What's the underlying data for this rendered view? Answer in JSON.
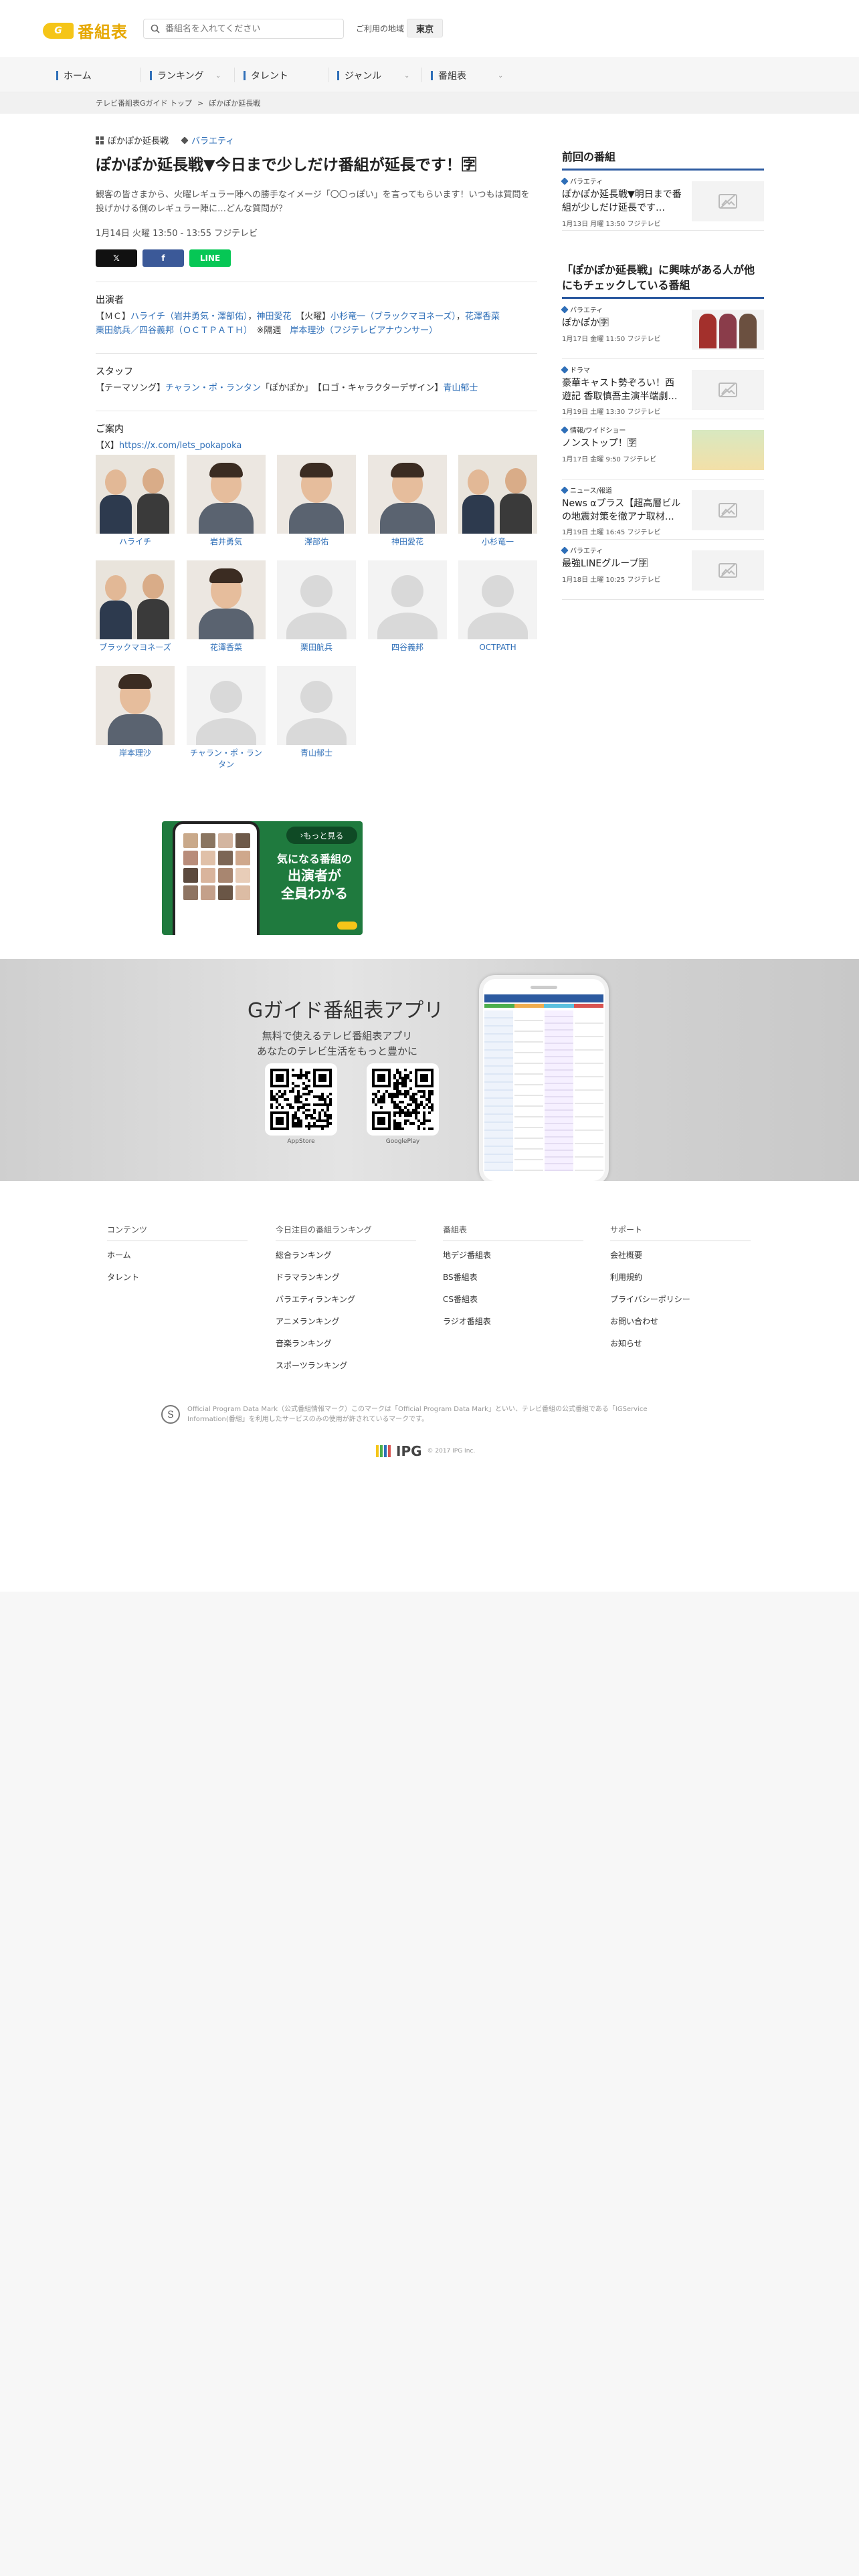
{
  "header": {
    "logo_mark": "G",
    "logo_text": "番組表",
    "search_placeholder": "番組名を入れてください",
    "region_label": "ご利用の地域",
    "region_value": "東京"
  },
  "nav": {
    "items": [
      {
        "label": "ホーム"
      },
      {
        "label": "ランキング"
      },
      {
        "label": "タレント"
      },
      {
        "label": "ジャンル"
      },
      {
        "label": "番組表"
      }
    ]
  },
  "breadcrumb": [
    "テレビ番組表Gガイド トップ",
    ">",
    "ぽかぽか延長戦"
  ],
  "program": {
    "series": "ぽかぽか延長戦",
    "genre": "バラエティ",
    "title": "ぽかぽか延長戦▼今日まで少しだけ番組が延長です！🈑",
    "description": "観客の皆さまから、火曜レギュラー陣への勝手なイメージ「〇〇っぽい」を言ってもらいます！いつもは質問を投げかける側のレギュラー陣に…どんな質問が？",
    "time": "1月14日 火曜 13:50 - 13:55 フジテレビ",
    "share": {
      "x": "𝕏",
      "facebook": "f",
      "line": "LINE"
    }
  },
  "cast_section": {
    "heading": "出演者",
    "line1_prefix": "【ＭＣ】",
    "mc": "ハライチ（岩井勇気・澤部佑）",
    "sep1": "，",
    "mc2": "神田愛花",
    "line1_mid": "　【火曜】",
    "tue1": "小杉竜一（ブラックマヨネーズ）",
    "tue_sep": "，",
    "tue2": "花澤香菜",
    "line2_a": "栗田航兵／四谷義邦（ＯＣＴＰＡＴＨ）",
    "line2_b": "　※隔週　",
    "line2_c": "岸本理沙（フジテレビアナウンサー）"
  },
  "staff_section": {
    "heading": "スタッフ",
    "prefix": "【テーマソング】",
    "song_artist": "チャラン・ポ・ランタン",
    "song_title": "「ぽかぽか」",
    "logo_prefix": "　【ロゴ・キャラクターデザイン】",
    "designer": "青山郁士"
  },
  "info_section": {
    "heading": "ご案内",
    "prefix": "【X】",
    "link": "https://x.com/lets_pokapoka"
  },
  "cast": [
    {
      "name": "ハライチ",
      "photo": "duo"
    },
    {
      "name": "岩井勇気",
      "photo": "person"
    },
    {
      "name": "澤部佑",
      "photo": "person"
    },
    {
      "name": "神田愛花",
      "photo": "person"
    },
    {
      "name": "小杉竜一",
      "photo": "duo"
    },
    {
      "name": "ブラックマヨネーズ",
      "photo": "duo"
    },
    {
      "name": "花澤香菜",
      "photo": "person"
    },
    {
      "name": "栗田航兵",
      "photo": "placeholder"
    },
    {
      "name": "四谷義邦",
      "photo": "placeholder"
    },
    {
      "name": "OCTPATH",
      "photo": "placeholder"
    },
    {
      "name": "岸本理沙",
      "photo": "person"
    },
    {
      "name": "チャラン・ポ・ランタン",
      "photo": "placeholder"
    },
    {
      "name": "青山郁士",
      "photo": "placeholder"
    }
  ],
  "ad": {
    "more": "もっと見る",
    "line1": "気になる番組の",
    "line2": "出演者が",
    "line3": "全員わかる"
  },
  "app_promo": {
    "title": "Gガイド番組表アプリ",
    "sub1": "無料で使えるテレビ番組表アプリ",
    "sub2": "あなたのテレビ生活をもっと豊かに",
    "qr1_label": "AppStore",
    "qr2_label": "GooglePlay"
  },
  "footer": {
    "columns": [
      {
        "heading": "コンテンツ",
        "links": [
          "ホーム",
          "タレント"
        ]
      },
      {
        "heading": "今日注目の番組ランキング",
        "links": [
          "総合ランキング",
          "ドラマランキング",
          "バラエティランキング",
          "アニメランキング",
          "音楽ランキング",
          "スポーツランキング"
        ]
      },
      {
        "heading": "番組表",
        "links": [
          "地デジ番組表",
          "BS番組表",
          "CS番組表",
          "ラジオ番組表"
        ]
      },
      {
        "heading": "サポート",
        "links": [
          "会社概要",
          "利用規約",
          "プライバシーポリシー",
          "お問い合わせ",
          "お知らせ"
        ]
      }
    ],
    "opd_text": "Official Program Data Mark（公式番組情報マーク）このマークは「Official Program Data Mark」といい、テレビ番組の公式番組である「IGService Information(番組」を利用したサービスのみの使用が許されているマークです。",
    "ipg": "IPG",
    "copyright": "© 2017 IPG Inc."
  },
  "sidebar": {
    "prev_heading": "前回の番組",
    "prev": [
      {
        "genre": "バラエティ",
        "title": "ぽかぽか延長戦▼明日まで番組が少しだけ延長です…",
        "date": "1月13日 月曜 13:50 フジテレビ",
        "thumb": "placeholder"
      }
    ],
    "related_heading": "「ぽかぽか延長戦」に興味がある人が他にもチェックしている番組",
    "related": [
      {
        "genre": "バラエティ",
        "title": "ぽかぽか🈑",
        "date": "1月17日 金曜 11:50 フジテレビ",
        "thumb": "people"
      },
      {
        "genre": "ドラマ",
        "title": "豪華キャスト勢ぞろい！西遊記 香取慎吾主演半端劇…",
        "date": "1月19日 土曜 13:30 フジテレビ",
        "thumb": "placeholder"
      },
      {
        "genre": "情報/ワイドショー",
        "title": "ノンストップ！🈑",
        "date": "1月17日 金曜 9:50 フジテレビ",
        "thumb": "studio"
      },
      {
        "genre": "ニュース/報道",
        "title": "News αプラス【超高層ビルの地震対策を徹アナ取材…",
        "date": "1月19日 土曜 16:45 フジテレビ",
        "thumb": "placeholder"
      },
      {
        "genre": "バラエティ",
        "title": "最強LINEグループ🈑",
        "date": "1月18日 土曜 10:25 フジテレビ",
        "thumb": "placeholder"
      }
    ]
  },
  "colors": {
    "accent": "#2f6fb8",
    "brand": "#f5c518",
    "navy": "#2c5aa0",
    "line_green": "#06c755",
    "facebook": "#3b5998"
  }
}
